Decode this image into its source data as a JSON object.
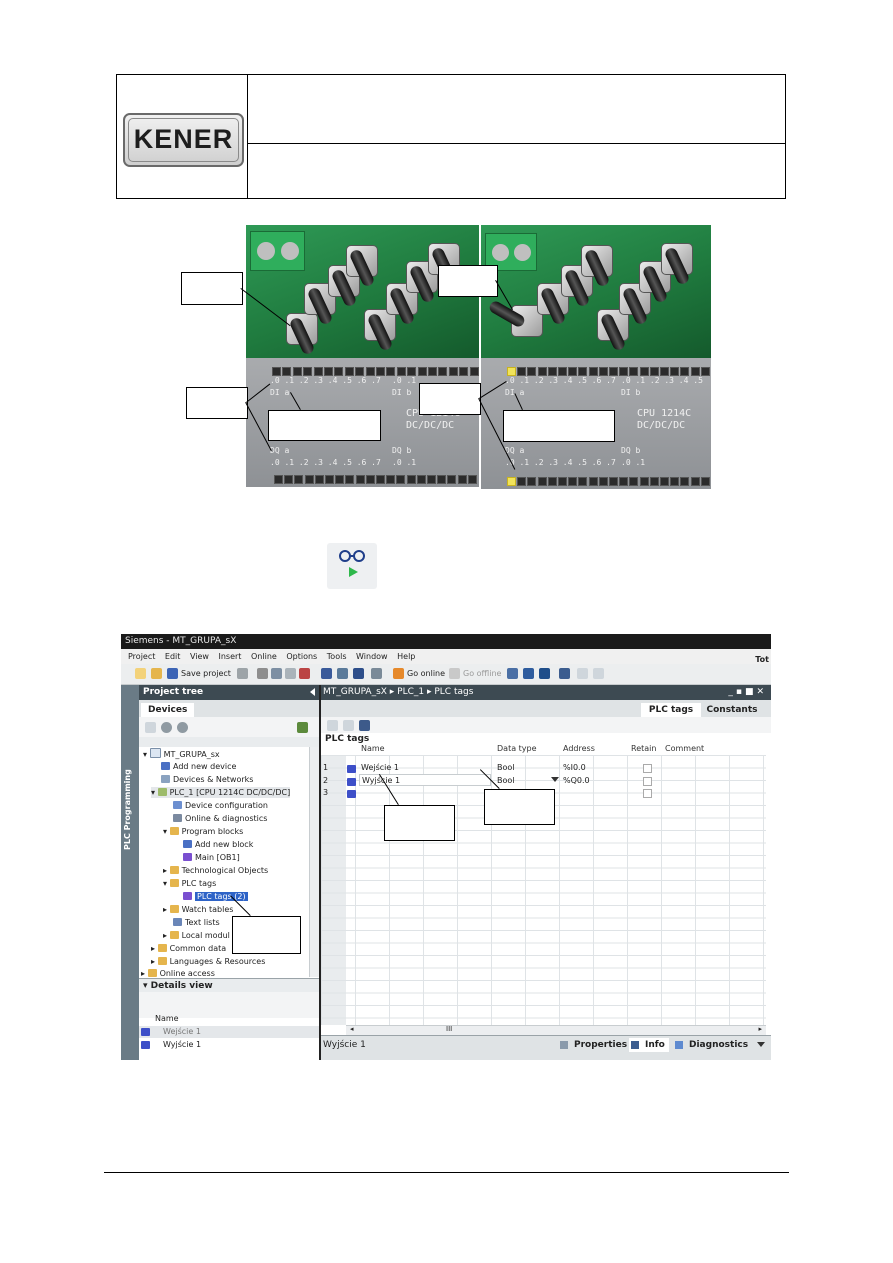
{
  "header": {
    "logo_text": "KENER",
    "row1_text": "",
    "row2_text": ""
  },
  "photo_left": {
    "di_label": "DI a",
    "di_digits": ".0 .1 .2 .3 .4 .5 .6 .7",
    "di_b_label": "DI b",
    "di_b_digits": ".0 .1",
    "dq_label": "DQ a",
    "dq_digits": ".0 .1 .2 .3 .4 .5 .6 .7",
    "dq_b_label": "DQ b",
    "dq_b_digits": ".0 .1",
    "cpu_line1": "CPU 1214C",
    "cpu_line2": "DC/DC/DC"
  },
  "photo_right": {
    "di_label": "DI a",
    "di_digits": ".0 .1 .2 .3 .4 .5 .6 .7",
    "di_b_label": "DI b",
    "di_b_digits": ".0 .1 .2 .3 .4 .5",
    "dq_label": "DQ a",
    "dq_digits": ".0 .1 .2 .3 .4 .5 .6 .7",
    "dq_b_label": "DQ b",
    "dq_b_digits": ".0 .1",
    "cpu_line1": "CPU 1214C",
    "cpu_line2": "DC/DC/DC"
  },
  "monitor_icon": "glasses-play-icon",
  "tia": {
    "title": "Siemens  -  MT_GRUPA_sX",
    "menu": [
      "Project",
      "Edit",
      "View",
      "Insert",
      "Online",
      "Options",
      "Tools",
      "Window",
      "Help"
    ],
    "menu_right": "Tot",
    "toolbar": {
      "save_label": "Save project",
      "go_online": "Go online",
      "go_offline": "Go offline"
    },
    "side_label": "PLC Programming",
    "project_tree": {
      "title": "Project tree",
      "tab": "Devices",
      "items": [
        "MT_GRUPA_sx",
        "Add new device",
        "Devices & Networks",
        "PLC_1 [CPU 1214C DC/DC/DC]",
        "Device configuration",
        "Online & diagnostics",
        "Program blocks",
        "Add new block",
        "Main [OB1]",
        "Technological Objects",
        "PLC tags",
        "PLC tags (2)",
        "Watch tables",
        "Text lists",
        "Local modul",
        "Common data",
        "Languages & Resources",
        "Online access"
      ],
      "details_title": "Details view",
      "details_col": "Name",
      "details_rows": [
        "Wejście 1",
        "Wyjście 1"
      ]
    },
    "breadcrumb": "MT_GRUPA_sX  ▸  PLC_1  ▸  PLC tags",
    "editor_tabs": [
      "PLC tags",
      "Constants"
    ],
    "table_title": "PLC tags",
    "columns": [
      "Name",
      "Data type",
      "Address",
      "Retain",
      "Comment"
    ],
    "rows": [
      {
        "num": "1",
        "name": "Wejście 1",
        "type": "Bool",
        "address": "%I0.0"
      },
      {
        "num": "2",
        "name": "Wyjście 1",
        "type": "Bool",
        "address": "%Q0.0"
      },
      {
        "num": "3",
        "name": "",
        "type": "",
        "address": ""
      }
    ],
    "scroll_mark": "III",
    "status_name": "Wyjście 1",
    "status_tabs": [
      "Properties",
      "Info",
      "Diagnostics"
    ]
  }
}
